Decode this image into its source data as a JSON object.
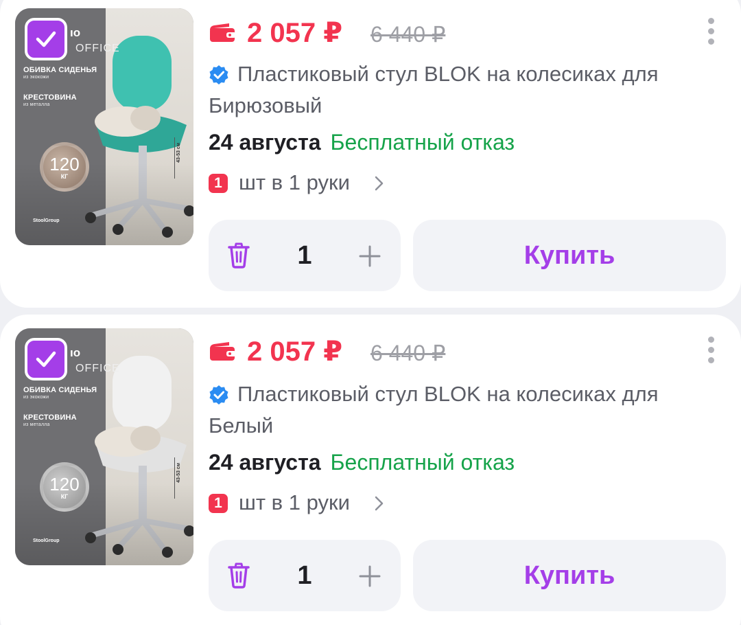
{
  "products": [
    {
      "selected": true,
      "image_text": {
        "brand": "ıo",
        "office": "OFFICE",
        "seat_label": "ОБИВКА СИДЕНЬЯ",
        "seat_sub": "из экокожи",
        "base_label": "КРЕСТОВИНА",
        "base_sub": "из металла",
        "load_value": "120",
        "load_unit": "КГ",
        "height": "43-53 см",
        "logo": "StoolGroup"
      },
      "price_current": "2 057 ₽",
      "price_old": "6 440 ₽",
      "title": "Пластиковый стул BLOK на колесиках для",
      "variant": "Бирюзовый",
      "delivery_date": "24 августа",
      "delivery_note": "Бесплатный отказ",
      "limit_count": "1",
      "limit_text": "шт в 1 руки",
      "quantity": "1",
      "buy_label": "Купить",
      "seat_color": "#3fc1b0"
    },
    {
      "selected": true,
      "image_text": {
        "brand": "ıo",
        "office": "OFFICE",
        "seat_label": "ОБИВКА СИДЕНЬЯ",
        "seat_sub": "из экокожи",
        "base_label": "КРЕСТОВИНА",
        "base_sub": "из металла",
        "load_value": "120",
        "load_unit": "КГ",
        "height": "43-53 см",
        "logo": "StoolGroup"
      },
      "price_current": "2 057 ₽",
      "price_old": "6 440 ₽",
      "title": "Пластиковый стул BLOK на колесиках для",
      "variant": "Белый",
      "delivery_date": "24 августа",
      "delivery_note": "Бесплатный отказ",
      "limit_count": "1",
      "limit_text": "шт в 1 руки",
      "quantity": "1",
      "buy_label": "Купить",
      "seat_color": "#f1f1f1"
    }
  ],
  "colors": {
    "accent": "#a43ee8",
    "price": "#f2344f",
    "success": "#16a34a",
    "verified": "#2b8cf2"
  }
}
